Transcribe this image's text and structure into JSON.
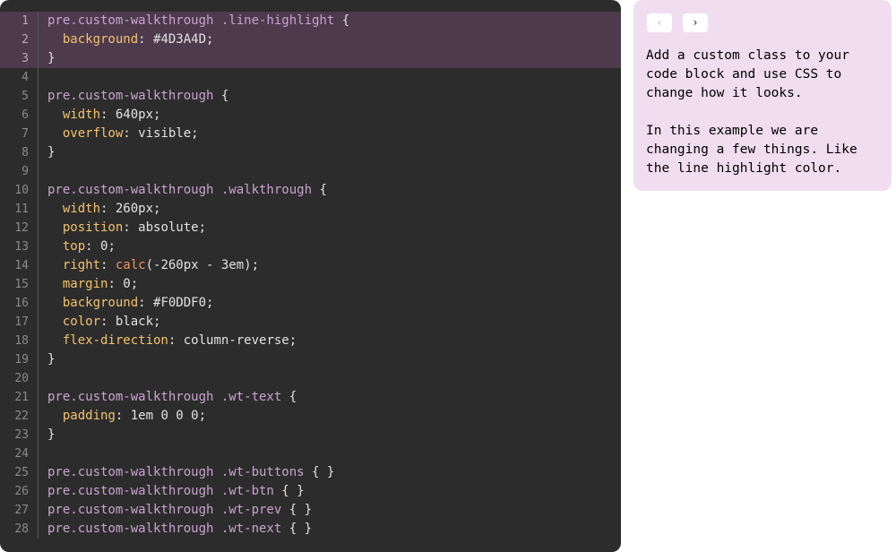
{
  "colors": {
    "code_background": "#2c2c2c",
    "line_highlight": "#4D3A4D",
    "walkthrough_background": "#F0DDF0"
  },
  "walkthrough": {
    "prev_icon": "chevron-left-icon",
    "prev_glyph": "‹",
    "next_icon": "chevron-right-icon",
    "next_glyph": "›",
    "paragraphs": [
      "Add a custom class to your code block and use CSS to change how it looks.",
      "In this example we are changing a few things. Like the line highlight color."
    ]
  },
  "code": {
    "highlighted_lines": [
      1,
      2,
      3
    ],
    "lines": [
      [
        [
          "sel",
          "pre.custom-walkthrough .line-highlight "
        ],
        [
          "pun",
          "{"
        ]
      ],
      [
        [
          "pun",
          "  "
        ],
        [
          "prop",
          "background"
        ],
        [
          "pun",
          ": "
        ],
        [
          "val",
          "#4D3A4D"
        ],
        [
          "pun",
          ";"
        ]
      ],
      [
        [
          "pun",
          "}"
        ]
      ],
      [],
      [
        [
          "sel",
          "pre.custom-walkthrough "
        ],
        [
          "pun",
          "{"
        ]
      ],
      [
        [
          "pun",
          "  "
        ],
        [
          "prop",
          "width"
        ],
        [
          "pun",
          ": "
        ],
        [
          "val",
          "640px"
        ],
        [
          "pun",
          ";"
        ]
      ],
      [
        [
          "pun",
          "  "
        ],
        [
          "prop",
          "overflow"
        ],
        [
          "pun",
          ": "
        ],
        [
          "val",
          "visible"
        ],
        [
          "pun",
          ";"
        ]
      ],
      [
        [
          "pun",
          "}"
        ]
      ],
      [],
      [
        [
          "sel",
          "pre.custom-walkthrough .walkthrough "
        ],
        [
          "pun",
          "{"
        ]
      ],
      [
        [
          "pun",
          "  "
        ],
        [
          "prop",
          "width"
        ],
        [
          "pun",
          ": "
        ],
        [
          "val",
          "260px"
        ],
        [
          "pun",
          ";"
        ]
      ],
      [
        [
          "pun",
          "  "
        ],
        [
          "prop",
          "position"
        ],
        [
          "pun",
          ": "
        ],
        [
          "val",
          "absolute"
        ],
        [
          "pun",
          ";"
        ]
      ],
      [
        [
          "pun",
          "  "
        ],
        [
          "prop",
          "top"
        ],
        [
          "pun",
          ": "
        ],
        [
          "val",
          "0"
        ],
        [
          "pun",
          ";"
        ]
      ],
      [
        [
          "pun",
          "  "
        ],
        [
          "prop",
          "right"
        ],
        [
          "pun",
          ": "
        ],
        [
          "fn",
          "calc"
        ],
        [
          "val",
          "(-260px - 3em)"
        ],
        [
          "pun",
          ";"
        ]
      ],
      [
        [
          "pun",
          "  "
        ],
        [
          "prop",
          "margin"
        ],
        [
          "pun",
          ": "
        ],
        [
          "val",
          "0"
        ],
        [
          "pun",
          ";"
        ]
      ],
      [
        [
          "pun",
          "  "
        ],
        [
          "prop",
          "background"
        ],
        [
          "pun",
          ": "
        ],
        [
          "val",
          "#F0DDF0"
        ],
        [
          "pun",
          ";"
        ]
      ],
      [
        [
          "pun",
          "  "
        ],
        [
          "prop",
          "color"
        ],
        [
          "pun",
          ": "
        ],
        [
          "val",
          "black"
        ],
        [
          "pun",
          ";"
        ]
      ],
      [
        [
          "pun",
          "  "
        ],
        [
          "prop",
          "flex-direction"
        ],
        [
          "pun",
          ": "
        ],
        [
          "val",
          "column-reverse"
        ],
        [
          "pun",
          ";"
        ]
      ],
      [
        [
          "pun",
          "}"
        ]
      ],
      [],
      [
        [
          "sel",
          "pre.custom-walkthrough .wt-text "
        ],
        [
          "pun",
          "{"
        ]
      ],
      [
        [
          "pun",
          "  "
        ],
        [
          "prop",
          "padding"
        ],
        [
          "pun",
          ": "
        ],
        [
          "val",
          "1em 0 0 0"
        ],
        [
          "pun",
          ";"
        ]
      ],
      [
        [
          "pun",
          "}"
        ]
      ],
      [],
      [
        [
          "sel",
          "pre.custom-walkthrough .wt-buttons "
        ],
        [
          "pun",
          "{ }"
        ]
      ],
      [
        [
          "sel",
          "pre.custom-walkthrough .wt-btn "
        ],
        [
          "pun",
          "{ }"
        ]
      ],
      [
        [
          "sel",
          "pre.custom-walkthrough .wt-prev "
        ],
        [
          "pun",
          "{ }"
        ]
      ],
      [
        [
          "sel",
          "pre.custom-walkthrough .wt-next "
        ],
        [
          "pun",
          "{ }"
        ]
      ]
    ]
  }
}
